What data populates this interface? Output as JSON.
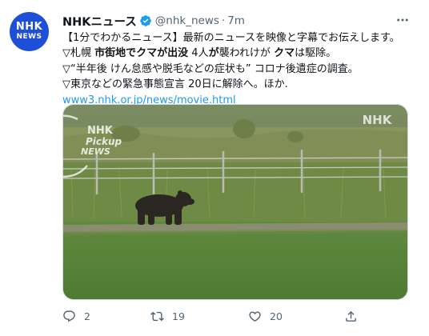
{
  "account": {
    "avatar_line1": "NHK",
    "avatar_line2": "NEWS",
    "display_name": "NHKニュース",
    "handle": "@nhk_news",
    "separator": "·",
    "time": "7m",
    "verified": true
  },
  "tweet": {
    "lines": [
      [
        {
          "t": "【1分でわかるニュース】最新のニュースを映像と字幕でお伝えします。",
          "b": false
        }
      ],
      [
        {
          "t": "▽札幌 ",
          "b": false
        },
        {
          "t": "市街地でクマが出没",
          "b": true
        },
        {
          "t": " 4人",
          "b": false
        },
        {
          "t": "が",
          "b": true
        },
        {
          "t": "襲われけが ",
          "b": false
        },
        {
          "t": "クマ",
          "b": true
        },
        {
          "t": "は駆除。",
          "b": false
        }
      ],
      [
        {
          "t": "▽“半年後 けん怠感や脱毛などの症状も” コロナ後遺症の調査。",
          "b": false
        }
      ],
      [
        {
          "t": "▽東京などの緊急事態宣言 20日に解除へ。ほか.",
          "b": false
        }
      ]
    ],
    "link": "www3.nhk.or.jp/news/movie.html"
  },
  "media": {
    "watermark_tr": "NHK",
    "watermark_nhk": "NHK",
    "watermark_pickup": "Pickup",
    "watermark_news": "NEWS"
  },
  "actions": {
    "reply_count": "2",
    "retweet_count": "19",
    "like_count": "20"
  },
  "colors": {
    "accent": "#1d9bf0",
    "muted": "#536471",
    "brand": "#1d4fd8"
  },
  "icons": [
    "verified-badge-icon",
    "more-horizontal-icon",
    "reply-icon",
    "retweet-icon",
    "like-icon",
    "share-icon"
  ]
}
